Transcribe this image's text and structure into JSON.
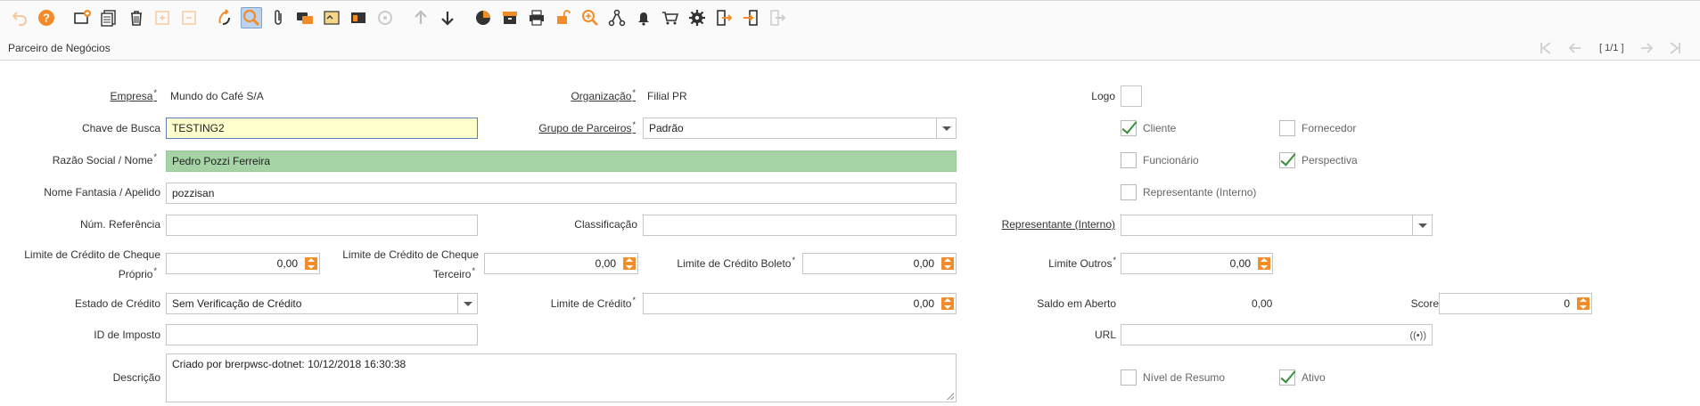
{
  "header": {
    "title": "Parceiro de Negócios",
    "record_count": "[ 1/1 ]"
  },
  "toolbar": {
    "icons": [
      "undo-icon",
      "help-icon",
      "new-record-icon",
      "copy-record-icon",
      "delete-icon",
      "save-icon",
      "ignore-icon",
      "refresh-icon",
      "find-icon",
      "attachment-icon",
      "chat-icon",
      "note-icon",
      "grid-toggle-icon",
      "history-icon",
      "parent-record-icon",
      "detail-record-icon",
      "chart-icon",
      "archive-icon",
      "print-icon",
      "lock-icon",
      "zoom-across-icon",
      "workflow-icon",
      "alert-icon",
      "product-info-icon",
      "settings-icon",
      "export-icon",
      "import-icon",
      "exit-icon"
    ]
  },
  "fields": {
    "empresa": {
      "label": "Empresa",
      "value": "Mundo do Café S/A"
    },
    "organizacao": {
      "label": "Organização",
      "value": "Filial PR"
    },
    "logo": {
      "label": "Logo"
    },
    "chave_busca": {
      "label": "Chave de Busca",
      "value": "TESTING2"
    },
    "grupo_parceiros": {
      "label": "Grupo de Parceiros",
      "value": "Padrão"
    },
    "razao_social": {
      "label": "Razão Social / Nome",
      "value": "Pedro Pozzi Ferreira"
    },
    "nome_fantasia": {
      "label": "Nome Fantasia / Apelido",
      "value": "pozzisan"
    },
    "num_referencia": {
      "label": "Núm. Referência",
      "value": ""
    },
    "classificacao": {
      "label": "Classificação",
      "value": ""
    },
    "representante": {
      "label": "Representante (Interno)",
      "value": ""
    },
    "lim_cheque_proprio": {
      "label_line1": "Limite de Crédito de Cheque",
      "label_line2": "Próprio",
      "value": "0,00"
    },
    "lim_cheque_terceiro": {
      "label_line1": "Limite de Crédito de Cheque",
      "label_line2": "Terceiro",
      "value": "0,00"
    },
    "lim_boleto": {
      "label": "Limite de Crédito Boleto",
      "value": "0,00"
    },
    "lim_outros": {
      "label": "Limite Outros",
      "value": "0,00"
    },
    "estado_credito": {
      "label": "Estado de Crédito",
      "value": "Sem Verificação de Crédito"
    },
    "lim_credito": {
      "label": "Limite de Crédito",
      "value": "0,00"
    },
    "saldo_aberto": {
      "label": "Saldo em Aberto",
      "value": "0,00"
    },
    "score": {
      "label": "Score",
      "value": "0"
    },
    "id_imposto": {
      "label": "ID de Imposto",
      "value": ""
    },
    "url": {
      "label": "URL",
      "value": ""
    },
    "descricao": {
      "label": "Descrição",
      "value": "Criado por brerpwsc-dotnet: 10/12/2018 16:30:38"
    }
  },
  "checkboxes": {
    "cliente": {
      "label": "Cliente",
      "checked": true
    },
    "fornecedor": {
      "label": "Fornecedor",
      "checked": false
    },
    "funcionario": {
      "label": "Funcionário",
      "checked": false
    },
    "perspectiva": {
      "label": "Perspectiva",
      "checked": true
    },
    "representante_interno": {
      "label": "Representante (Interno)",
      "checked": false
    },
    "nivel_resumo": {
      "label": "Nível de Resumo",
      "checked": false
    },
    "ativo": {
      "label": "Ativo",
      "checked": true
    }
  },
  "colors": {
    "accent": "#f28c28",
    "focused_bg": "#ffffcc",
    "mandatory_bg": "#a6d3a6",
    "check": "#3a8f3a"
  }
}
